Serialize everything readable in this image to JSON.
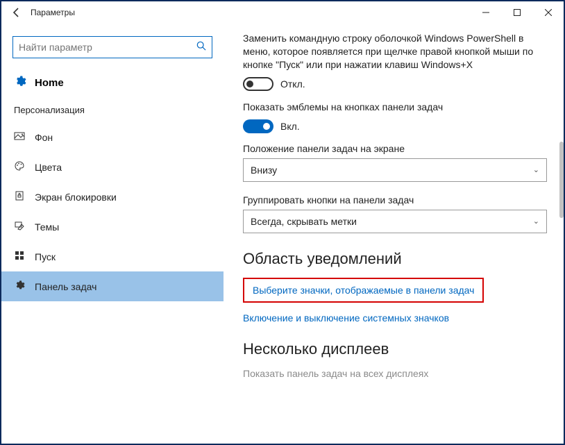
{
  "window": {
    "title": "Параметры"
  },
  "search": {
    "placeholder": "Найти параметр"
  },
  "home": {
    "label": "Home"
  },
  "category": "Персонализация",
  "nav": [
    {
      "label": "Фон"
    },
    {
      "label": "Цвета"
    },
    {
      "label": "Экран блокировки"
    },
    {
      "label": "Темы"
    },
    {
      "label": "Пуск"
    },
    {
      "label": "Панель задач"
    }
  ],
  "main": {
    "powershell_text": "Заменить командную строку оболочкой Windows PowerShell в меню, которое появляется при щелчке правой кнопкой мыши по кнопке \"Пуск\" или при нажатии клавиш Windows+X",
    "off_label": "Откл.",
    "badges_text": "Показать эмблемы на кнопках панели задач",
    "on_label": "Вкл.",
    "position_label": "Положение панели задач на экране",
    "position_value": "Внизу",
    "group_label": "Группировать кнопки на панели задач",
    "group_value": "Всегда, скрывать метки",
    "section_notify": "Область уведомлений",
    "link_select_icons": "Выберите значки, отображаемые в панели задач",
    "link_system_icons": "Включение и выключение системных значков",
    "section_multi": "Несколько дисплеев",
    "multi_text": "Показать панель задач на всех дисплеях"
  }
}
